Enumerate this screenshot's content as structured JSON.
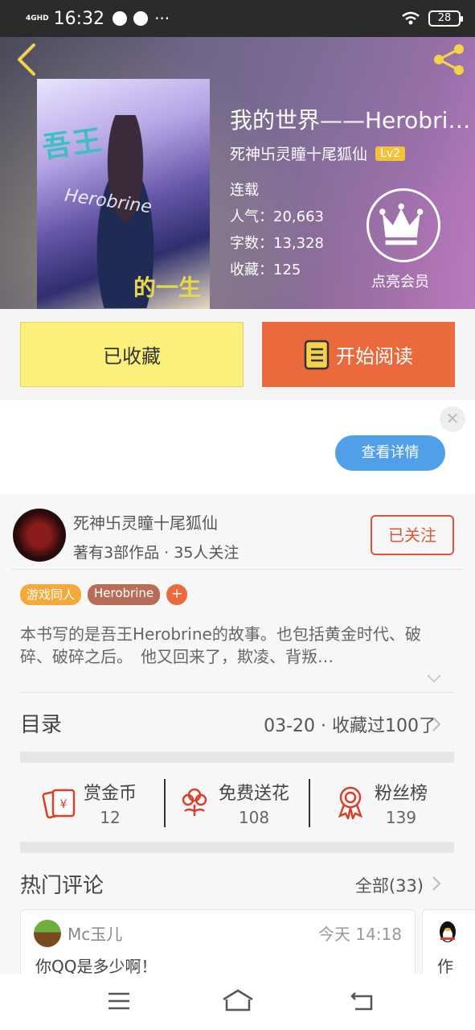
{
  "status_bar": {
    "network": "4GHD",
    "time": "16:32",
    "battery": "28"
  },
  "book": {
    "cover_text_1": "吾王",
    "cover_text_2": "Herobrine",
    "cover_text_3": "的一生",
    "title": "我的世界——Herobrine的一生",
    "author": "死神卐灵瞳十尾狐仙",
    "level": "Lv2",
    "status": "连载",
    "popularity": "人气：20,663",
    "word_count": "字数：13,328",
    "favorites": "收藏：125",
    "vip_label": "点亮会员"
  },
  "actions": {
    "collected_label": "已收藏",
    "read_label": "开始阅读"
  },
  "ad": {
    "details_label": "查看详情",
    "close_glyph": "✕"
  },
  "author_block": {
    "name": "死神卐灵瞳十尾狐仙",
    "meta": "著有3部作品 · 35人关注",
    "follow_label": "已关注",
    "tags": [
      {
        "label": "游戏同人",
        "color": "#f4a93a"
      },
      {
        "label": "Herobrine",
        "color": "#b86e56"
      }
    ],
    "tag_add": "+",
    "description": "本书写的是吾王Herobrine的故事。也包括黄金时代、破碎、破碎之后。　他又回来了，欺凌、背叛…",
    "toc_label": "目录",
    "toc_info": "03-20 · 收藏过100了"
  },
  "rewards": [
    {
      "label": "赏金币",
      "value": "12",
      "icon": "red-envelope-icon"
    },
    {
      "label": "免费送花",
      "value": "108",
      "icon": "flower-icon"
    },
    {
      "label": "粉丝榜",
      "value": "139",
      "icon": "medal-icon"
    }
  ],
  "comments": {
    "title": "热门评论",
    "all_label": "全部(33)",
    "items": [
      {
        "user": "Mc玉儿",
        "time": "今天 14:18",
        "text": "你QQ是多少啊！"
      },
      {
        "text": "作"
      }
    ]
  },
  "colors": {
    "accent_orange": "#ea6a3e",
    "collect_yellow": "#fbf07c",
    "link_blue": "#4fa0e8",
    "follow_red": "#e1543a"
  }
}
